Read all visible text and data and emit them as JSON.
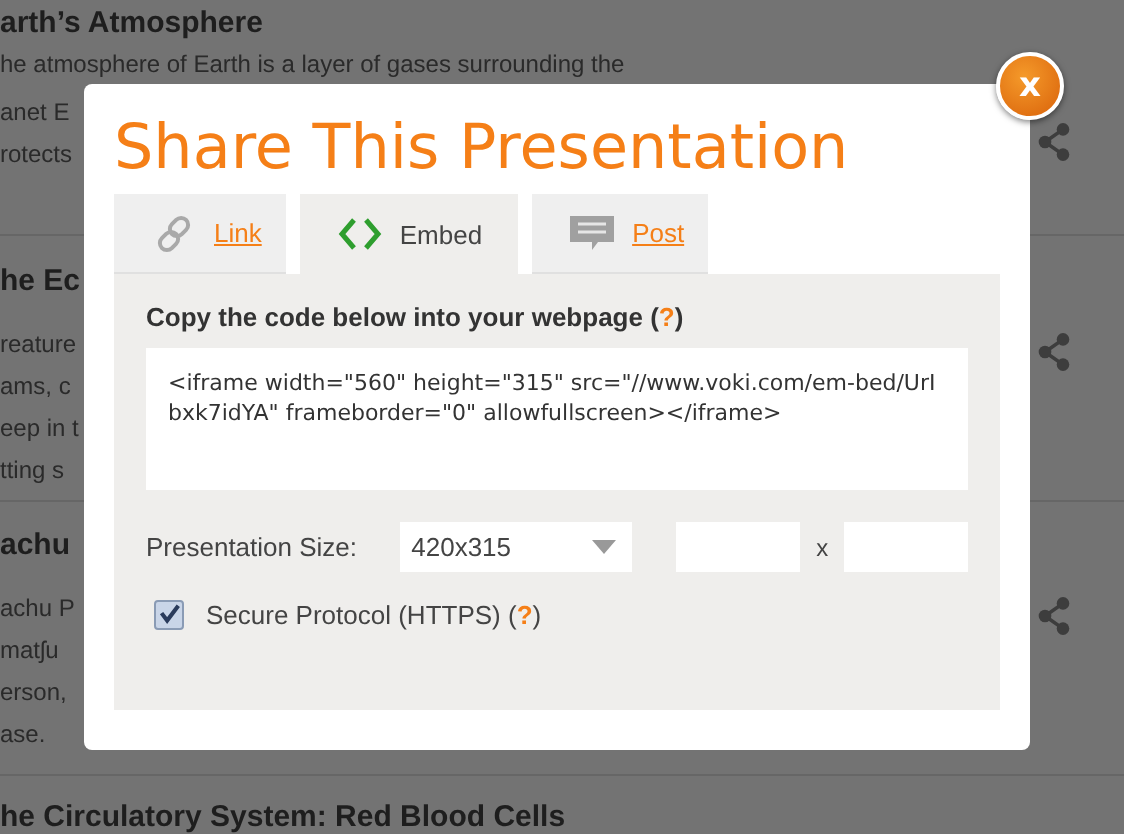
{
  "articles": [
    {
      "title": "arth’s Atmosphere",
      "lines": [
        "he atmosphere of Earth is a layer of gases surrounding the",
        "anet E",
        "rotects"
      ]
    },
    {
      "title": "he Ec",
      "lines": [
        "reature",
        "ams, c",
        "eep in t",
        "tting s"
      ]
    },
    {
      "title": "achu",
      "lines": [
        "achu P",
        "matʃu",
        "erson,",
        "ase."
      ]
    },
    {
      "title": "he Circulatory System: Red Blood Cells"
    }
  ],
  "dialog": {
    "title": "Share This Presentation",
    "close": "x",
    "tabs": [
      {
        "label": "Link",
        "kind": "link",
        "selected": false
      },
      {
        "label": "Embed",
        "kind": "code",
        "selected": true
      },
      {
        "label": "Post",
        "kind": "comment",
        "selected": false
      }
    ],
    "heading": "Copy the code below into your webpage (**?**)",
    "embed_code": "<iframe width=\"560\" height=\"315\" src=\"//www.voki.com/em-bed/UrIbxk7idYA\" frameborder=\"0\" allowfullscreen></iframe>",
    "size": {
      "label": "Presentation Size:",
      "value": "420x315",
      "separator": "x"
    },
    "secure": {
      "label": "Secure Protocol (HTTPS) (**?**)",
      "checked": true
    }
  }
}
